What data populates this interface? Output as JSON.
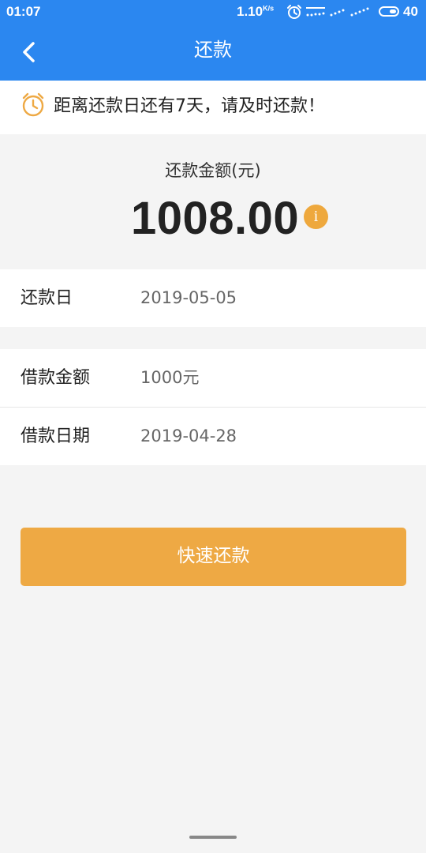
{
  "status_bar": {
    "time": "01:07",
    "net_speed": "1.10",
    "net_speed_unit": "K/s",
    "alarm_icon": "alarm-icon",
    "signal_icons": "network-signal-icons",
    "battery_icon": "battery-icon",
    "battery_level": "40"
  },
  "header": {
    "back_icon": "chevron-left-icon",
    "title": "还款"
  },
  "notice": {
    "icon": "alarm-clock-icon",
    "text": "距离还款日还有7天，请及时还款！"
  },
  "summary": {
    "label": "还款金额(元)",
    "amount": "1008.00",
    "info_icon": "info-icon",
    "info_glyph": "i"
  },
  "details": {
    "repay_date": {
      "label": "还款日",
      "value": "2019-05-05"
    },
    "loan_amount": {
      "label": "借款金额",
      "value": "1000元"
    },
    "loan_date": {
      "label": "借款日期",
      "value": "2019-04-28"
    }
  },
  "action": {
    "button_label": "快速还款"
  },
  "colors": {
    "primary": "#2b87f0",
    "accent": "#eea944",
    "background": "#f4f4f4"
  }
}
